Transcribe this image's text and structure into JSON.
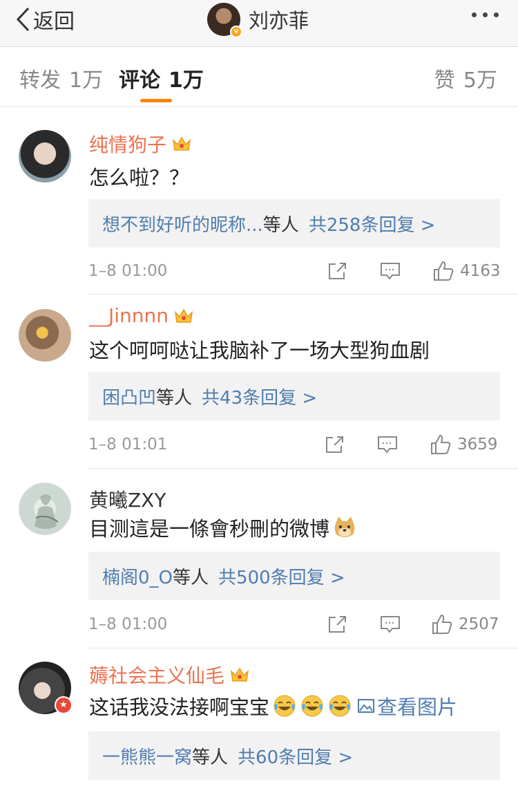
{
  "nav": {
    "back_label": "返回",
    "title": "刘亦菲",
    "verified_mark": "v"
  },
  "tabs": {
    "reposts_label": "转发",
    "reposts_count": "1万",
    "comments_label": "评论",
    "comments_count": "1万",
    "likes_label": "赞",
    "likes_count": "5万"
  },
  "colors": {
    "accent": "#ff8200",
    "username_vip": "#eb7350",
    "link": "#507daf"
  },
  "comments": [
    {
      "username": "纯情狗子",
      "vip": true,
      "text": "怎么啦？？",
      "reply_users": "想不到好听的昵称...",
      "reply_suffix": "等人",
      "reply_total": "共258条回复 >",
      "time": "1–8 01:00",
      "likes": "4163"
    },
    {
      "username": "__Jinnnn",
      "vip": true,
      "text": "这个呵呵哒让我脑补了一场大型狗血剧",
      "reply_users": "困凸凹",
      "reply_suffix": "等人",
      "reply_total": "共43条回复 >",
      "time": "1–8 01:01",
      "likes": "3659"
    },
    {
      "username": "黄曦ZXY",
      "vip": false,
      "text": "目测這是一條會秒刪的微博",
      "emoji": "doge-icon",
      "reply_users": "楠阁0_O",
      "reply_suffix": "等人",
      "reply_total": "共500条回复 >",
      "time": "1–8 01:00",
      "likes": "2507"
    },
    {
      "username": "薅社会主义仙毛",
      "vip": true,
      "text": "这话我没法接啊宝宝",
      "emoji": "laugh-cry-icon",
      "pic_label": "查看图片",
      "reply_users": "一熊熊一窝",
      "reply_suffix": "等人",
      "reply_total": "共60条回复 >"
    }
  ]
}
